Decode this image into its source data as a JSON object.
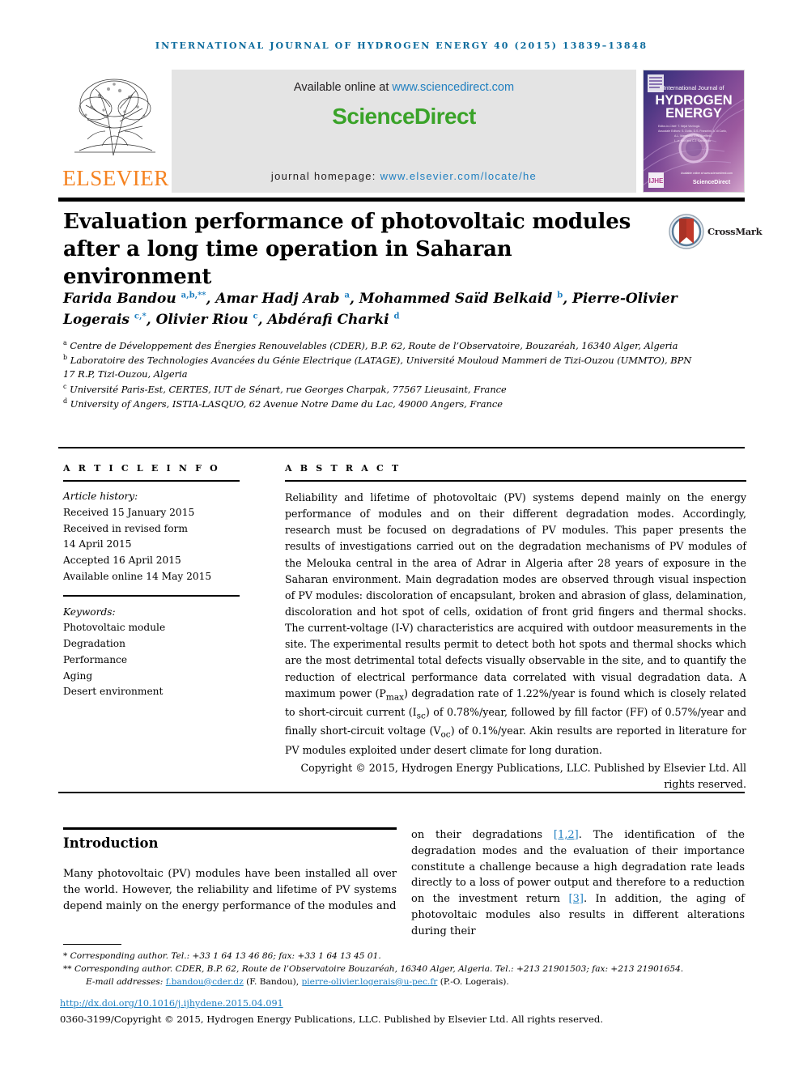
{
  "running_head": "INTERNATIONAL JOURNAL OF HYDROGEN ENERGY 40 (2015) 13839–13848",
  "masthead": {
    "publisher_wordmark": "ELSEVIER",
    "available_prefix": "Available online at ",
    "available_url": "www.sciencedirect.com",
    "sciencedirect_wordmark": "ScienceDirect",
    "homepage_prefix": "journal homepage: ",
    "homepage_url": "www.elsevier.com/locate/he",
    "cover": {
      "line1": "International Journal of",
      "line2": "HYDROGEN",
      "line3": "ENERGY",
      "editors_line1": "Editor-in-Chief:  T. Nejat Veziroğlu",
      "editors_line2": "Associate Editors:  S. Dutta, D.S. Franchini, A. di Carlo,",
      "editors_line3": "A.L. Mamedov, J.W. Sheffield,",
      "editors_line4": "L.-n. Sun and C.J. Sandroglu",
      "footer_text": "Available online at www.sciencedirect.com",
      "sd_footer": "ScienceDirect"
    }
  },
  "title": "Evaluation performance of photovoltaic modules after a long time operation in Saharan environment",
  "crossmark": {
    "label": "CrossMark"
  },
  "authors": [
    {
      "name": "Farida Bandou",
      "marks": "a,b,**"
    },
    {
      "name": "Amar Hadj Arab",
      "marks": "a"
    },
    {
      "name": "Mohammed Saïd Belkaid",
      "marks": "b"
    },
    {
      "name": "Pierre-Olivier Logerais",
      "marks": "c,*"
    },
    {
      "name": "Olivier Riou",
      "marks": "c"
    },
    {
      "name": "Abdérafi Charki",
      "marks": "d"
    }
  ],
  "affiliations": [
    {
      "mark": "a",
      "text": "Centre de Développement des Énergies Renouvelables (CDER), B.P. 62, Route de l’Observatoire, Bouzaréah, 16340 Alger, Algeria"
    },
    {
      "mark": "b",
      "text": "Laboratoire des Technologies Avancées du Génie Electrique (LATAGE), Université Mouloud Mammeri de Tizi-Ouzou (UMMTO), BPN 17 R.P, Tizi-Ouzou, Algeria"
    },
    {
      "mark": "c",
      "text": "Université Paris-Est, CERTES, IUT de Sénart, rue Georges Charpak, 77567 Lieusaint, France"
    },
    {
      "mark": "d",
      "text": "University of Angers, ISTIA-LASQUO, 62 Avenue Notre Dame du Lac, 49000 Angers, France"
    }
  ],
  "article_info": {
    "heading": "A R T I C L E   I N F O",
    "history_label": "Article history:",
    "history": [
      "Received 15 January 2015",
      "Received in revised form",
      "14 April 2015",
      "Accepted 16 April 2015",
      "Available online 14 May 2015"
    ],
    "keywords_label": "Keywords:",
    "keywords": [
      "Photovoltaic module",
      "Degradation",
      "Performance",
      "Aging",
      "Desert environment"
    ]
  },
  "abstract": {
    "heading": "A B S T R A C T",
    "text": "Reliability and lifetime of photovoltaic (PV) systems depend mainly on the energy performance of modules and on their different degradation modes. Accordingly, research must be focused on degradations of PV modules. This paper presents the results of investigations carried out on the degradation mechanisms of PV modules of the Melouka central in the area of Adrar in Algeria after 28 years of exposure in the Saharan environment. Main degradation modes are observed through visual inspection of PV modules: discoloration of encapsulant, broken and abrasion of glass, delamination, discoloration and hot spot of cells, oxidation of front grid fingers and thermal shocks. The current-voltage (I-V) characteristics are acquired with outdoor measurements in the site. The experimental results permit to detect both hot spots and thermal shocks which are the most detrimental total defects visually observable in the site, and to quantify the reduction of electrical performance data correlated with visual degradation data. A maximum power (Pmax) degradation rate of 1.22%/year is found which is closely related to short-circuit current (Isc) of 0.78%/year, followed by fill factor (FF) of 0.57%/year and finally short-circuit voltage (Voc) of 0.1%/year. Akin results are reported in literature for PV modules exploited under desert climate for long duration.",
    "copyright": "Copyright © 2015, Hydrogen Energy Publications, LLC. Published by Elsevier Ltd. All rights reserved."
  },
  "introduction": {
    "heading": "Introduction",
    "left_text": "Many photovoltaic (PV) modules have been installed all over the world. However, the reliability and lifetime of PV systems depend mainly on the energy performance of the modules and",
    "right_before_cite1": "on their degradations ",
    "cite1": "[1,2]",
    "right_mid": ". The identification of the degradation modes and the evaluation of their importance constitute a challenge because a high degradation rate leads directly to a loss of power output and therefore to a reduction on the investment return ",
    "cite2": "[3]",
    "right_after": ". In addition, the aging of photovoltaic modules also results in different alterations during their"
  },
  "footnotes": {
    "fn1_mark": "*",
    "fn1_text": "Corresponding author. Tel.: +33 1 64 13 46 86; fax: +33 1 64 13 45 01.",
    "fn2_mark": "**",
    "fn2_text": "Corresponding author. CDER, B.P. 62, Route de l’Observatoire Bouzaréah, 16340 Alger, Algeria. Tel.: +213 21901503; fax: +213 21901654.",
    "email_label": "E-mail addresses:",
    "email1": "f.bandou@cder.dz",
    "email1_owner": "(F. Bandou),",
    "email2": "pierre-olivier.logerais@u-pec.fr",
    "email2_owner": "(P.-O. Logerais).",
    "doi": "http://dx.doi.org/10.1016/j.ijhydene.2015.04.091",
    "issn_copyright": "0360-3199/Copyright © 2015, Hydrogen Energy Publications, LLC. Published by Elsevier Ltd. All rights reserved."
  },
  "colors": {
    "journal_blue": "#0a6a9c",
    "link_blue": "#1f7fc0",
    "elsevier_orange": "#f58220",
    "sciencedirect_green": "#3aa329",
    "banner_gray": "#e4e4e4"
  }
}
